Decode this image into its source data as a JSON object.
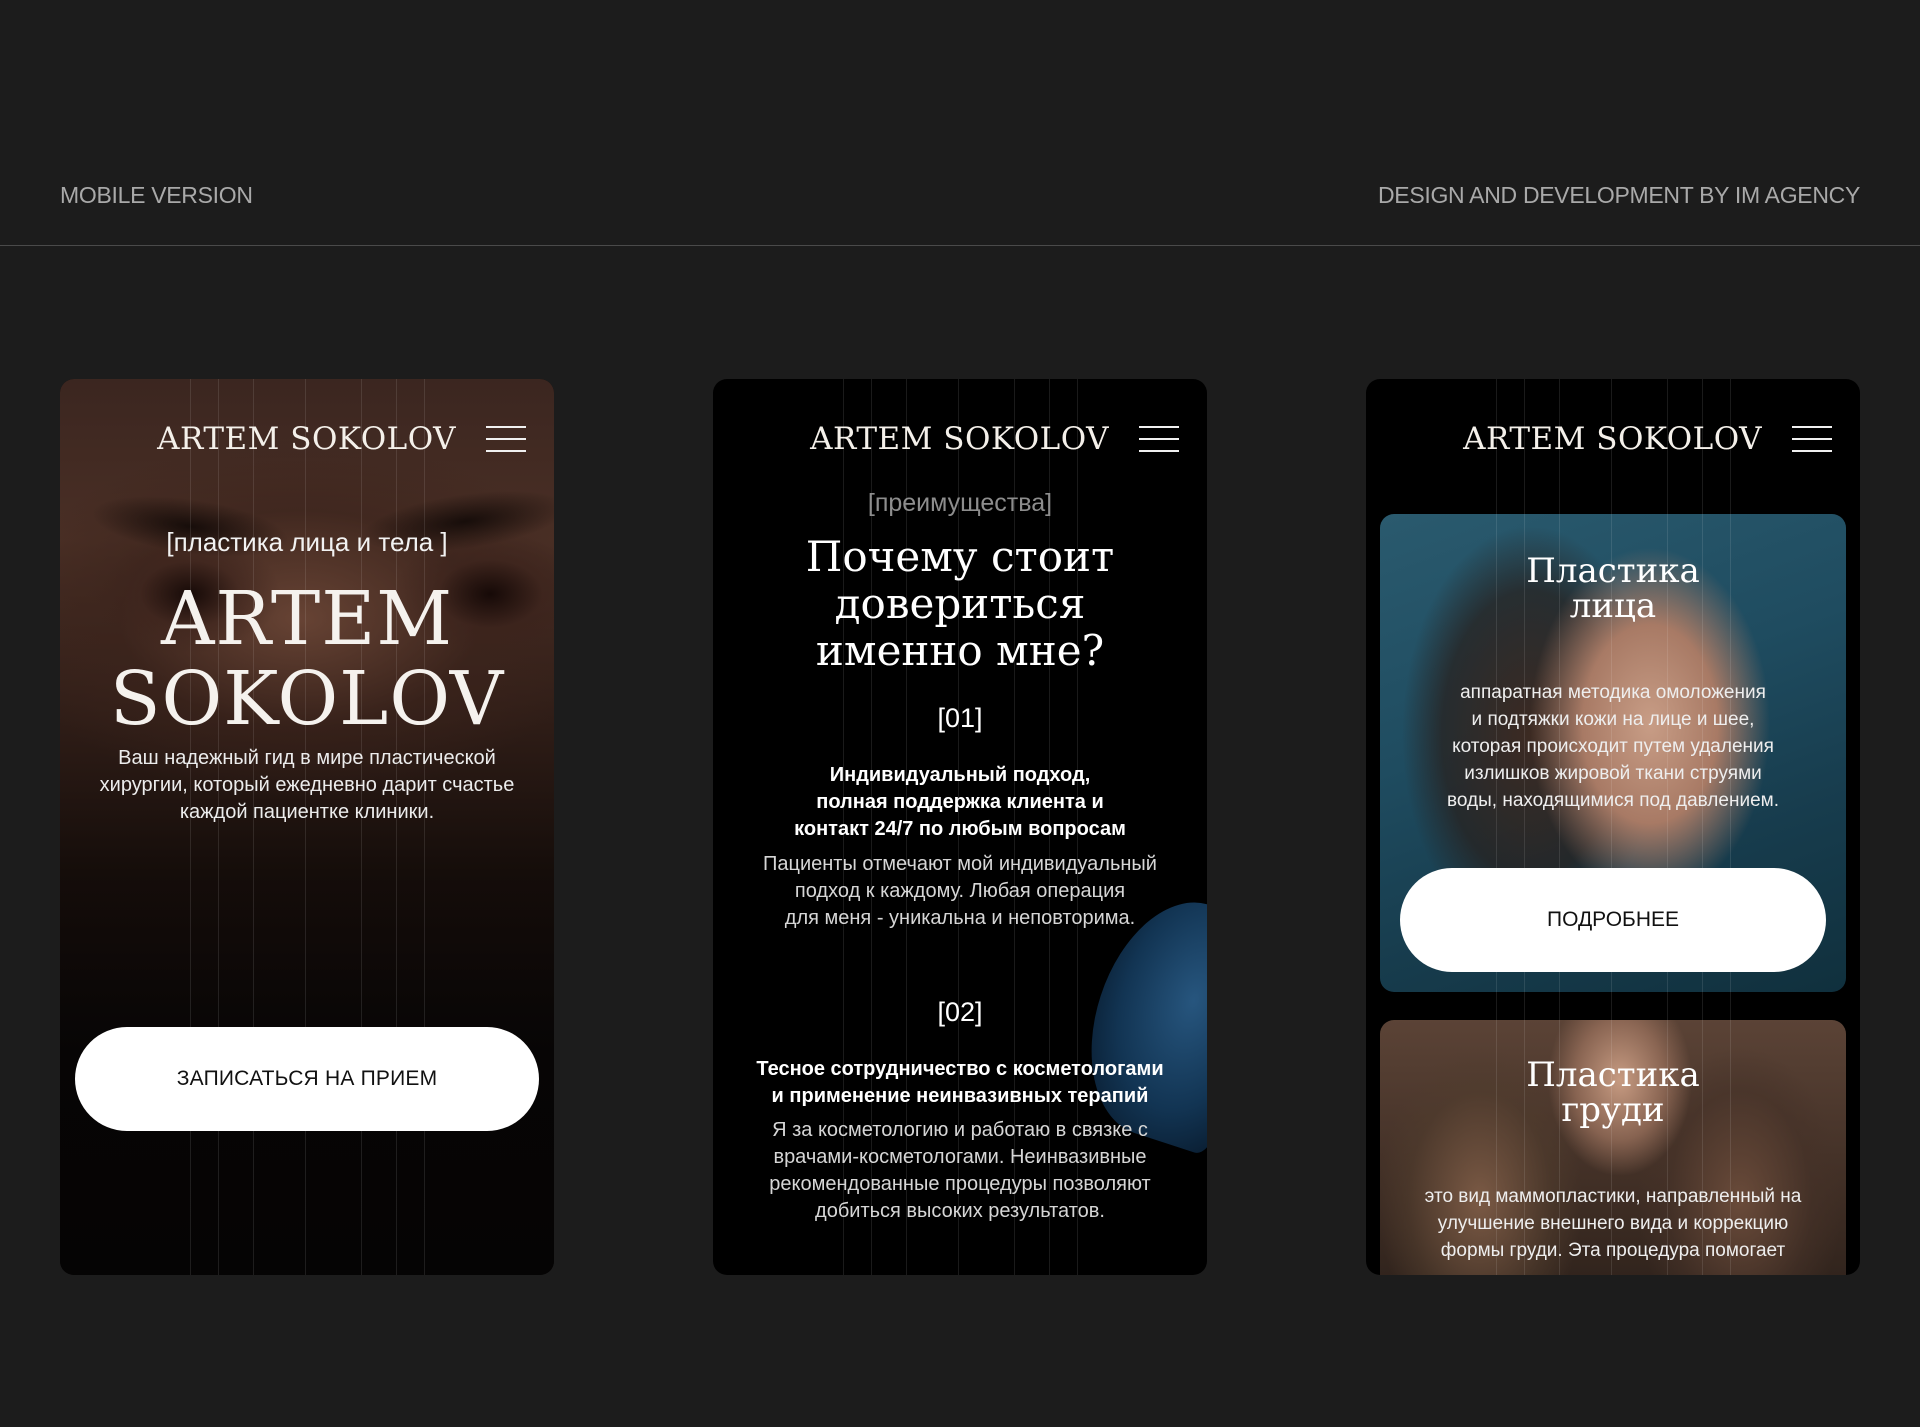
{
  "header": {
    "left": "MOBILE VERSION",
    "right": "DESIGN AND DEVELOPMENT BY IM AGENCY"
  },
  "brand": "ARTEM SOKOLOV",
  "phone1": {
    "tag": "[пластика лица и тела ]",
    "title_line1": "ARTEM",
    "title_line2": "SOKOLOV",
    "description": "Ваш надежный гид в мире пластической хирургии, который ежедневно дарит счастье каждой пациентке клиники.",
    "cta": "ЗАПИСАТЬСЯ НА ПРИЕМ"
  },
  "phone2": {
    "eyebrow": "[преимущества]",
    "title_lines": [
      "Почему стоит",
      "довериться",
      "именно мне?"
    ],
    "items": [
      {
        "num": "[01]",
        "heading_lines": [
          "Индивидуальный подход,",
          "полная поддержка клиента и",
          "контакт 24/7 по любым вопросам"
        ],
        "text_lines": [
          "Пациенты отмечают мой индивидуальный",
          "подход к каждому. Любая операция",
          "для меня - уникальна и неповторима."
        ]
      },
      {
        "num": "[02]",
        "heading_lines": [
          "Тесное сотрудничество с косметологами",
          "и применение неинвазивных терапий"
        ],
        "text_lines": [
          "Я за косметологию и работаю в связке с",
          "врачами-косметологами. Неинвазивные",
          "рекомендованные процедуры позволяют",
          "добиться высоких результатов."
        ]
      }
    ]
  },
  "phone3": {
    "cards": [
      {
        "title_lines": [
          "Пластика",
          "лица"
        ],
        "text_lines": [
          "аппаратная методика омоложения",
          "и подтяжки кожи на лице и шее,",
          "которая происходит путем удаления",
          "излишков жировой ткани струями",
          "воды, находящимися под давлением."
        ],
        "button": "ПОДРОБНЕЕ"
      },
      {
        "title_lines": [
          "Пластика",
          "груди"
        ],
        "text_lines": [
          "это вид маммопластики, направленный на",
          "улучшение внешнего вида и коррекцию",
          "формы груди. Эта процедура помогает"
        ]
      }
    ]
  },
  "icons": {
    "menu": "hamburger-menu-icon"
  }
}
